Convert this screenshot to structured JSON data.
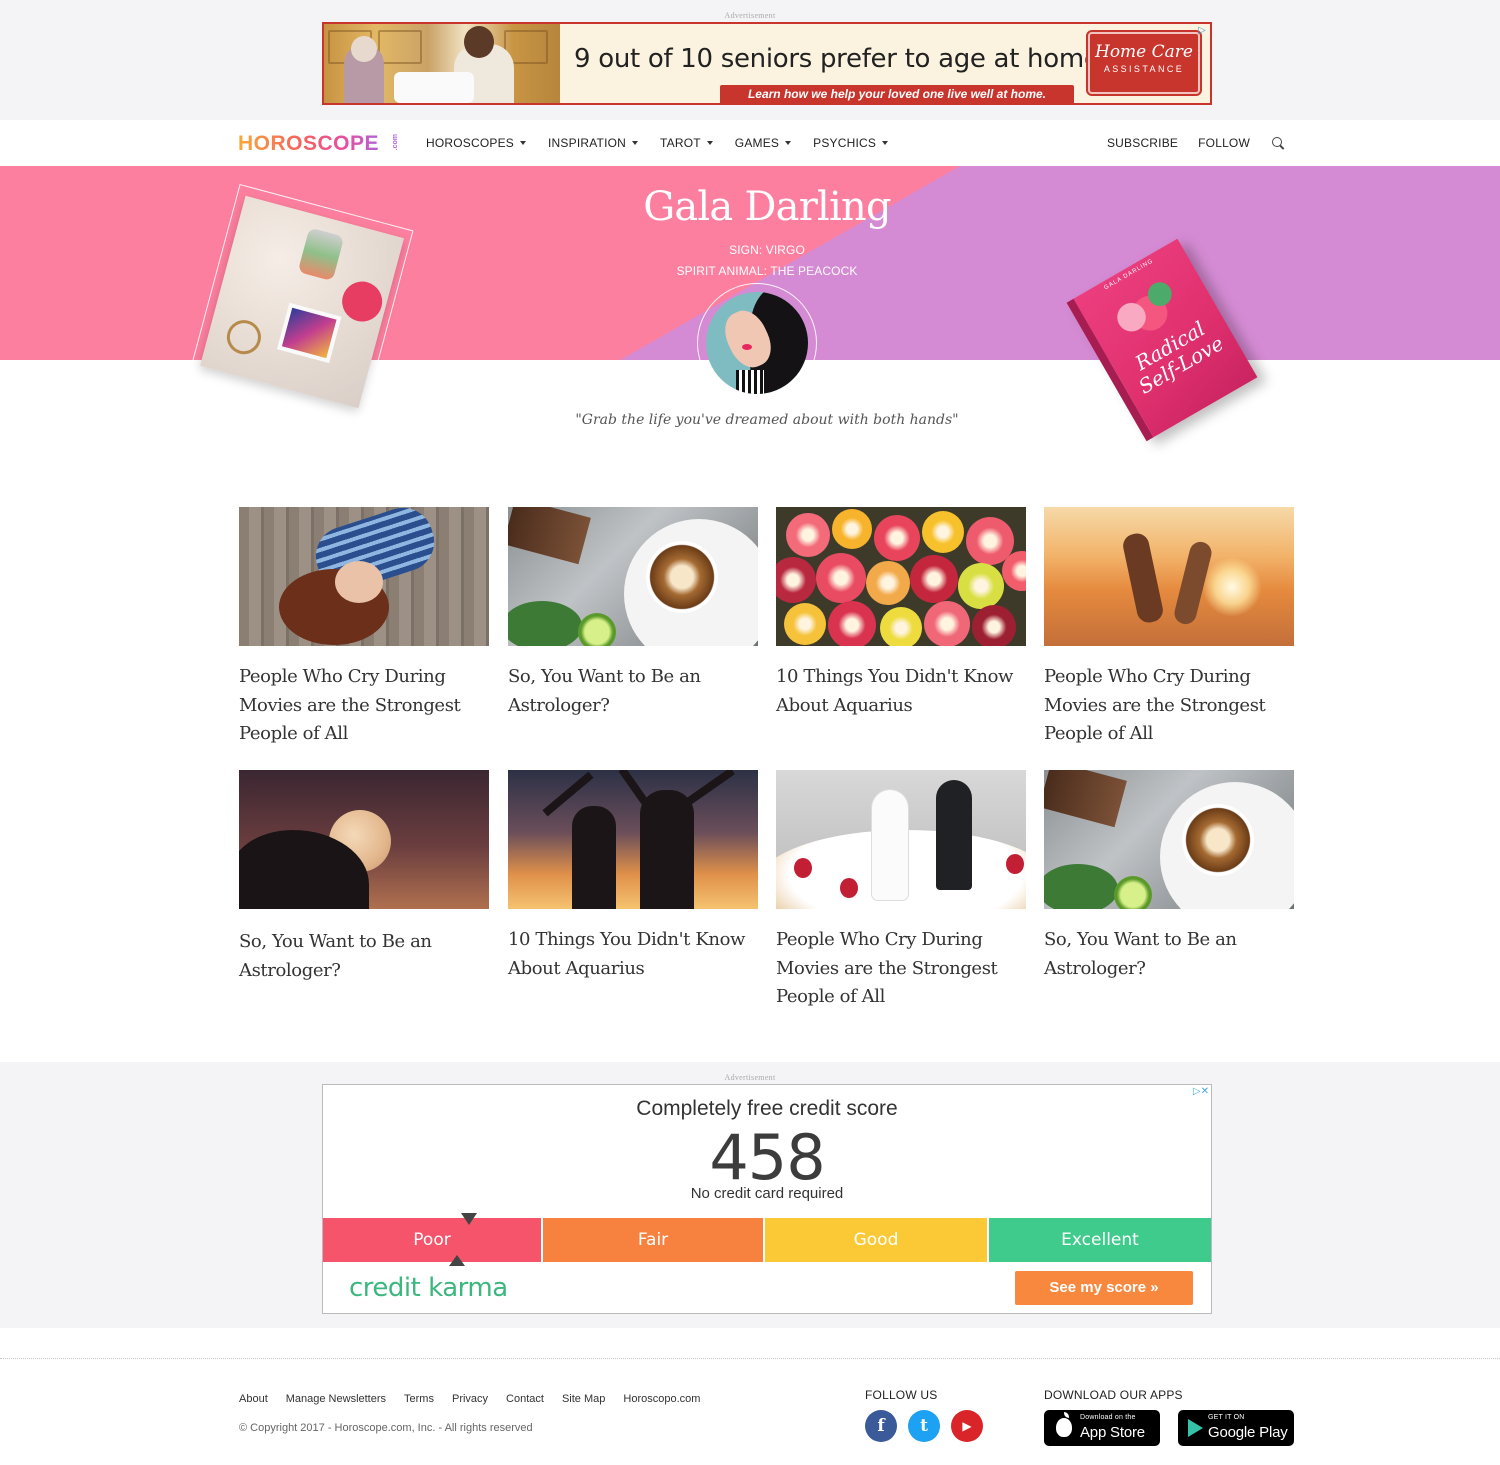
{
  "ads": {
    "label": "Advertisement",
    "top": {
      "headline": "9 out of 10 seniors prefer to age at home.",
      "subline": "Learn how we help your loved one live well at home.",
      "brand_line1": "Home Care",
      "brand_line2": "ASSISTANCE"
    },
    "credit": {
      "headline": "Completely free credit score",
      "score": "458",
      "subline": "No credit card required",
      "segments": [
        {
          "label": "Poor",
          "color": "#f5546a"
        },
        {
          "label": "Fair",
          "color": "#f7813e"
        },
        {
          "label": "Good",
          "color": "#fcc936"
        },
        {
          "label": "Excellent",
          "color": "#3fcb8c"
        }
      ],
      "brand": "credit karma",
      "cta": "See my score  »"
    }
  },
  "nav": {
    "logo": "HOROSCOPE",
    "logo_suffix": ".com",
    "menu": [
      "HOROSCOPES",
      "INSPIRATION",
      "TAROT",
      "GAMES",
      "PSYCHICS"
    ],
    "subscribe": "SUBSCRIBE",
    "follow": "FOLLOW"
  },
  "profile": {
    "name": "Gala Darling",
    "sign": "SIGN: VIRGO",
    "spirit_animal": "SPIRIT ANIMAL: THE PEACOCK",
    "quote": "\"Grab the life you've dreamed about with both hands\"",
    "book_author": "GALA DARLING",
    "book_title_1": "Radical",
    "book_title_2": "Self-Love"
  },
  "articles": [
    {
      "title": "People Who Cry During Movies are the Strongest People of All"
    },
    {
      "title": "So, You Want to Be an Astrologer?"
    },
    {
      "title": "10 Things You Didn't Know About Aquarius"
    },
    {
      "title": "People Who Cry During Movies are the Strongest People of All"
    },
    {
      "title": "So, You Want to Be an Astrologer?"
    },
    {
      "title": "10 Things You Didn't Know About Aquarius"
    },
    {
      "title": "People Who Cry During Movies are the Strongest People of All"
    },
    {
      "title": "So, You Want to Be an Astrologer?"
    }
  ],
  "footer": {
    "links": [
      "About",
      "Manage Newsletters",
      "Terms",
      "Privacy",
      "Contact",
      "Site Map",
      "Horoscopo.com"
    ],
    "copyright": "© Copyright 2017 - Horoscope.com, Inc. - All rights reserved",
    "follow_label": "FOLLOW US",
    "apps_label": "DOWNLOAD OUR APPS",
    "social": [
      {
        "icon": "facebook-icon",
        "glyph": "f",
        "color": "#3a5a99"
      },
      {
        "icon": "twitter-icon",
        "glyph": "t",
        "color": "#1da1f2"
      },
      {
        "icon": "youtube-icon",
        "glyph": "▶",
        "color": "#d9252a"
      }
    ],
    "app_store": {
      "small": "Download on the",
      "big": "App Store"
    },
    "google_play": {
      "small": "GET IT ON",
      "big": "Google Play"
    }
  }
}
